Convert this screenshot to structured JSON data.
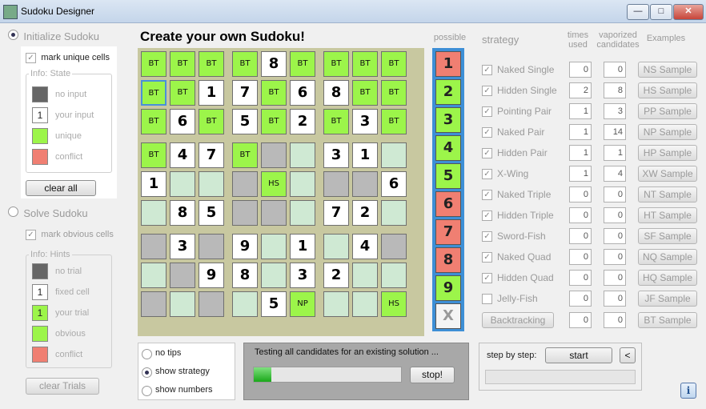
{
  "window": {
    "title": "Sudoku Designer",
    "minimize": "—",
    "maximize": "□",
    "close": "✕"
  },
  "left": {
    "init_label": "Initialize Sudoku",
    "mark_unique": "mark unique cells",
    "state_group": "Info: State",
    "state_legend": [
      {
        "label": "no input",
        "text": ""
      },
      {
        "label": "your input",
        "text": "1"
      },
      {
        "label": "unique",
        "text": ""
      },
      {
        "label": "conflict",
        "text": ""
      }
    ],
    "clear_all": "clear all",
    "solve_label": "Solve Sudoku",
    "mark_obvious": "mark obvious cells",
    "hints_group": "Info: Hints",
    "hints_legend": [
      {
        "label": "no trial",
        "text": ""
      },
      {
        "label": "fixed cell",
        "text": "1"
      },
      {
        "label": "your trial",
        "text": "1"
      },
      {
        "label": "obvious",
        "text": ""
      },
      {
        "label": "conflict",
        "text": ""
      }
    ],
    "clear_trials": "clear Trials"
  },
  "main": {
    "title": "Create your own Sudoku!",
    "possible_header": "possible"
  },
  "board": {
    "rows": [
      [
        "BT",
        "BT",
        "BT",
        "BT",
        "8",
        "BT",
        "BT",
        "BT",
        "BT"
      ],
      [
        "BT",
        "BT",
        "1",
        "7",
        "BT",
        "6",
        "8",
        "BT",
        "BT"
      ],
      [
        "BT",
        "6",
        "BT",
        "5",
        "BT",
        "2",
        "BT",
        "3",
        "BT"
      ],
      [
        "BT",
        "4",
        "7",
        "BT",
        "",
        "",
        "3",
        "1",
        ""
      ],
      [
        "1",
        "",
        "",
        "",
        "HS",
        "",
        "",
        "",
        "6"
      ],
      [
        "",
        "8",
        "5",
        "",
        "",
        "",
        "7",
        "2",
        ""
      ],
      [
        "",
        "3",
        "",
        "9",
        "",
        "1",
        "",
        "4",
        ""
      ],
      [
        "",
        "",
        "9",
        "8",
        "",
        "3",
        "2",
        "",
        ""
      ],
      [
        "",
        "",
        "",
        "",
        "5",
        "NP",
        "",
        "",
        "HS"
      ]
    ],
    "kinds": [
      [
        "g",
        "g",
        "g",
        "g",
        "w",
        "g",
        "g",
        "g",
        "g"
      ],
      [
        "s",
        "g",
        "w",
        "w",
        "g",
        "w",
        "w",
        "g",
        "g"
      ],
      [
        "g",
        "w",
        "g",
        "w",
        "g",
        "w",
        "g",
        "w",
        "g"
      ],
      [
        "g",
        "w",
        "w",
        "g",
        "d",
        "l",
        "w",
        "w",
        "l"
      ],
      [
        "w",
        "l",
        "l",
        "d",
        "g",
        "l",
        "d",
        "d",
        "w"
      ],
      [
        "l",
        "w",
        "w",
        "d",
        "d",
        "l",
        "w",
        "w",
        "l"
      ],
      [
        "d",
        "w",
        "d",
        "w",
        "l",
        "w",
        "l",
        "w",
        "d"
      ],
      [
        "l",
        "d",
        "w",
        "w",
        "l",
        "w",
        "w",
        "l",
        "l"
      ],
      [
        "d",
        "l",
        "d",
        "l",
        "w",
        "g",
        "l",
        "l",
        "g"
      ]
    ],
    "colors": {
      "g": "#9cf54a",
      "w": "#ffffff",
      "l": "#cfe9d3",
      "d": "#b9b9b9",
      "s": "#9cf54a"
    }
  },
  "possible": [
    {
      "label": "1",
      "color": "#f07f72"
    },
    {
      "label": "2",
      "color": "#9cf54a"
    },
    {
      "label": "3",
      "color": "#9cf54a"
    },
    {
      "label": "4",
      "color": "#9cf54a"
    },
    {
      "label": "5",
      "color": "#9cf54a"
    },
    {
      "label": "6",
      "color": "#f07f72"
    },
    {
      "label": "7",
      "color": "#f07f72"
    },
    {
      "label": "8",
      "color": "#f07f72"
    },
    {
      "label": "9",
      "color": "#9cf54a"
    },
    {
      "label": "X",
      "color": "#f4f4f4"
    }
  ],
  "strategy": {
    "header": "strategy",
    "col_times": "times used",
    "col_vaporized": "vaporized candidates",
    "col_examples": "Examples",
    "rows": [
      {
        "name": "Naked Single",
        "checked": true,
        "times": "0",
        "vaporized": "0",
        "sample": "NS Sample"
      },
      {
        "name": "Hidden Single",
        "checked": true,
        "times": "2",
        "vaporized": "8",
        "sample": "HS Sample"
      },
      {
        "name": "Pointing Pair",
        "checked": true,
        "times": "1",
        "vaporized": "3",
        "sample": "PP Sample"
      },
      {
        "name": "Naked Pair",
        "checked": true,
        "times": "1",
        "vaporized": "14",
        "sample": "NP Sample"
      },
      {
        "name": "Hidden Pair",
        "checked": true,
        "times": "1",
        "vaporized": "1",
        "sample": "HP Sample"
      },
      {
        "name": "X-Wing",
        "checked": true,
        "times": "1",
        "vaporized": "4",
        "sample": "XW Sample"
      },
      {
        "name": "Naked Triple",
        "checked": true,
        "times": "0",
        "vaporized": "0",
        "sample": "NT Sample"
      },
      {
        "name": "Hidden Triple",
        "checked": true,
        "times": "0",
        "vaporized": "0",
        "sample": "HT Sample"
      },
      {
        "name": "Sword-Fish",
        "checked": true,
        "times": "0",
        "vaporized": "0",
        "sample": "SF Sample"
      },
      {
        "name": "Naked Quad",
        "checked": true,
        "times": "0",
        "vaporized": "0",
        "sample": "NQ Sample"
      },
      {
        "name": "Hidden Quad",
        "checked": true,
        "times": "0",
        "vaporized": "0",
        "sample": "HQ Sample"
      },
      {
        "name": "Jelly-Fish",
        "checked": false,
        "times": "0",
        "vaporized": "0",
        "sample": "JF Sample"
      }
    ],
    "backtracking": {
      "label": "Backtracking",
      "times": "0",
      "vaporized": "0",
      "sample": "BT Sample"
    }
  },
  "tips": {
    "options": [
      "no tips",
      "show strategy",
      "show numbers"
    ],
    "selected": 1
  },
  "status": {
    "message": "Testing all candidates for an existing solution ...",
    "stop": "stop!",
    "progress": 0.12
  },
  "step": {
    "label": "step by step:",
    "start": "start",
    "back": "<"
  },
  "info_icon": "i"
}
